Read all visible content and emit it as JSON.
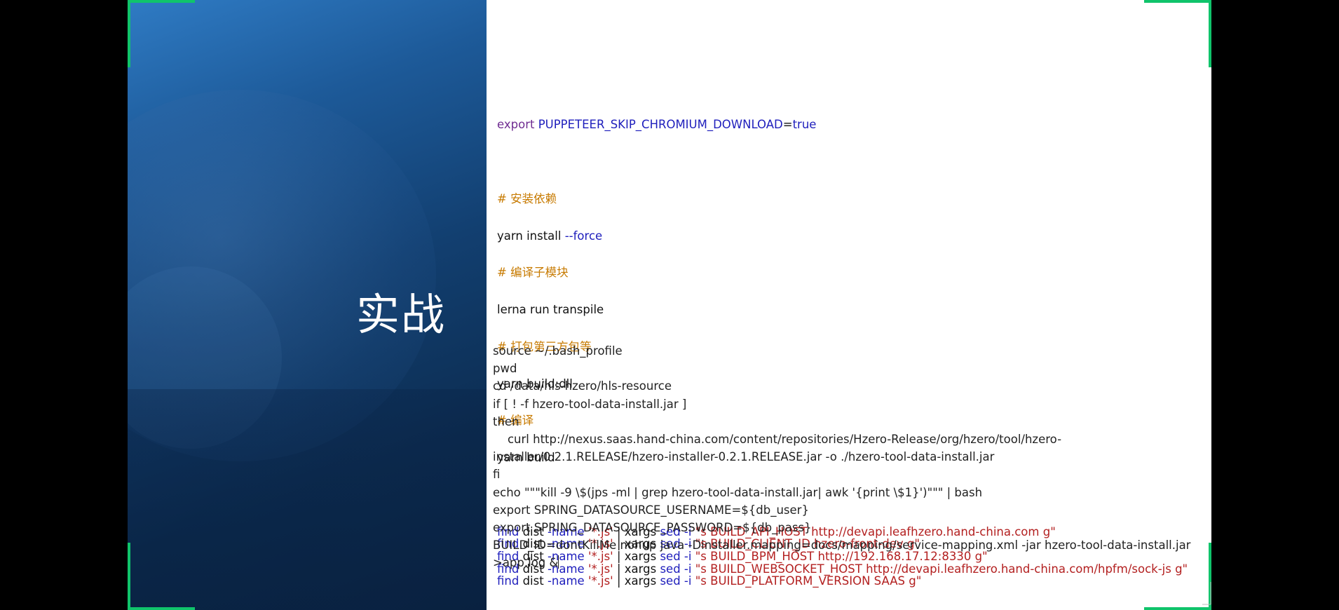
{
  "slide": {
    "title": "实战"
  },
  "code_top": {
    "export_line": {
      "keyword": "export",
      "variable": "PUPPETEER_SKIP_CHROMIUM_DOWNLOAD",
      "equals": "=",
      "value": "true"
    },
    "comments": {
      "install": "# 安装依赖",
      "compile_sub": "# 编译子模块",
      "pack_third": "# 打包第三方包等",
      "compile": "# 编译"
    },
    "commands": {
      "yarn_install": "yarn install ",
      "force_flag": "--force",
      "lerna": "lerna run transpile",
      "yarn_dll": "yarn build:dll",
      "yarn_build": "yarn build"
    },
    "find_lines": [
      {
        "find": "find",
        "dist": " dist ",
        "name": "-name",
        "pattern": " '*.js' ",
        "pipe": "| xargs ",
        "sed": "sed",
        "flag": " -i ",
        "expr": "\"s BUILD_API_HOST http://devapi.leafhzero.hand-china.com g\""
      },
      {
        "find": "find",
        "dist": " dist ",
        "name": "-name",
        "pattern": " '*.js' ",
        "pipe": "| xargs ",
        "sed": "sed",
        "flag": " -i ",
        "expr": "\"s BUILD_CLIENT_ID hzero-front-dev g\""
      },
      {
        "find": "find",
        "dist": " dist ",
        "name": "-name",
        "pattern": " '*.js' ",
        "pipe": "| xargs ",
        "sed": "sed",
        "flag": " -i ",
        "expr": "\"s BUILD_BPM_HOST http://192.168.17.12:8330 g\""
      },
      {
        "find": "find",
        "dist": " dist ",
        "name": "-name",
        "pattern": " '*.js' ",
        "pipe": "| xargs ",
        "sed": "sed",
        "flag": " -i ",
        "expr": "\"s BUILD_WEBSOCKET_HOST http://devapi.leafhzero.hand-china.com/hpfm/sock-js g\""
      },
      {
        "find": "find",
        "dist": " dist ",
        "name": "-name",
        "pattern": " '*.js' ",
        "pipe": "| xargs ",
        "sed": "sed",
        "flag": " -i ",
        "expr": "\"s BUILD_PLATFORM_VERSION SAAS g\""
      }
    ]
  },
  "code_bottom": {
    "lines": [
      "source ~/.bash_profile",
      "pwd",
      "cd /data/hls-hzero/hls-resource",
      "if [ ! -f hzero-tool-data-install.jar ]",
      "then",
      "    curl http://nexus.saas.hand-china.com/content/repositories/Hzero-Release/org/hzero/tool/hzero-",
      "installer/0.2.1.RELEASE/hzero-installer-0.2.1.RELEASE.jar -o ./hzero-tool-data-install.jar",
      "fi",
      "echo \"\"\"kill -9 \\$(jps -ml | grep hzero-tool-data-install.jar| awk '{print \\$1}')\"\"\" | bash",
      "export SPRING_DATASOURCE_USERNAME=${db_user}",
      "export SPRING_DATASOURCE_PASSWORD=${db_pass}",
      "BUILD_ID=dontKillMe nohup java -Dinstaller.mapping=docs/mapping/service-mapping.xml -jar hzero-tool-data-install.jar",
      ">app.log &"
    ]
  },
  "colors": {
    "accent_corners": "#10c46b",
    "keyword": "#6f2c91",
    "identifier": "#1e1ebc",
    "comment": "#c77a00",
    "string": "#b32020"
  }
}
